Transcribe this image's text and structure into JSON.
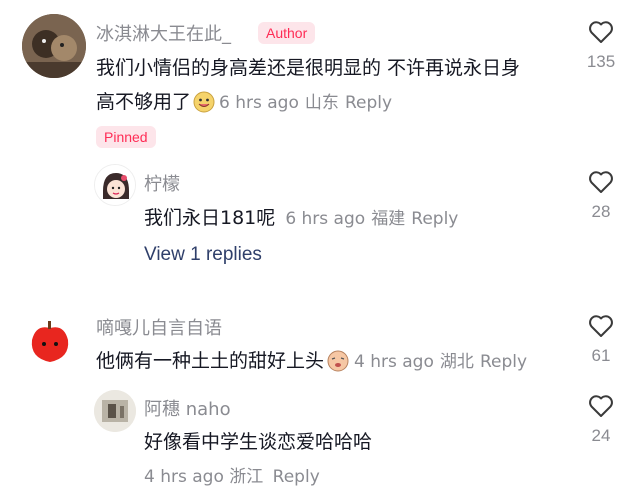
{
  "comments": [
    {
      "user": "冰淇淋大王在此_",
      "author_badge": "Author",
      "text_line1": "我们小情侣的身高差还是很明显的 不许再说永日身",
      "text_line2": "高不够用了",
      "time": "6 hrs ago",
      "location": "山东",
      "reply_label": "Reply",
      "likes": "135",
      "pinned_badge": "Pinned",
      "replies": [
        {
          "user": "柠檬",
          "text": "我们永日181呢",
          "time": "6 hrs ago",
          "location": "福建",
          "reply_label": "Reply",
          "likes": "28"
        }
      ],
      "view_replies": "View 1 replies"
    },
    {
      "user": "嘀嘎儿自言自语",
      "text": "他俩有一种土土的甜好上头",
      "time": "4 hrs ago",
      "location": "湖北",
      "reply_label": "Reply",
      "likes": "61",
      "replies": [
        {
          "user": "阿穗 naho",
          "text": "好像看中学生谈恋爱哈哈哈",
          "time": "4 hrs ago",
          "location": "浙江",
          "reply_label": "Reply",
          "likes": "24"
        }
      ]
    }
  ],
  "colors": {
    "text": "#161823",
    "muted": "#8a8b91",
    "accent": "#fe2c55",
    "link": "#2f3f6a"
  }
}
